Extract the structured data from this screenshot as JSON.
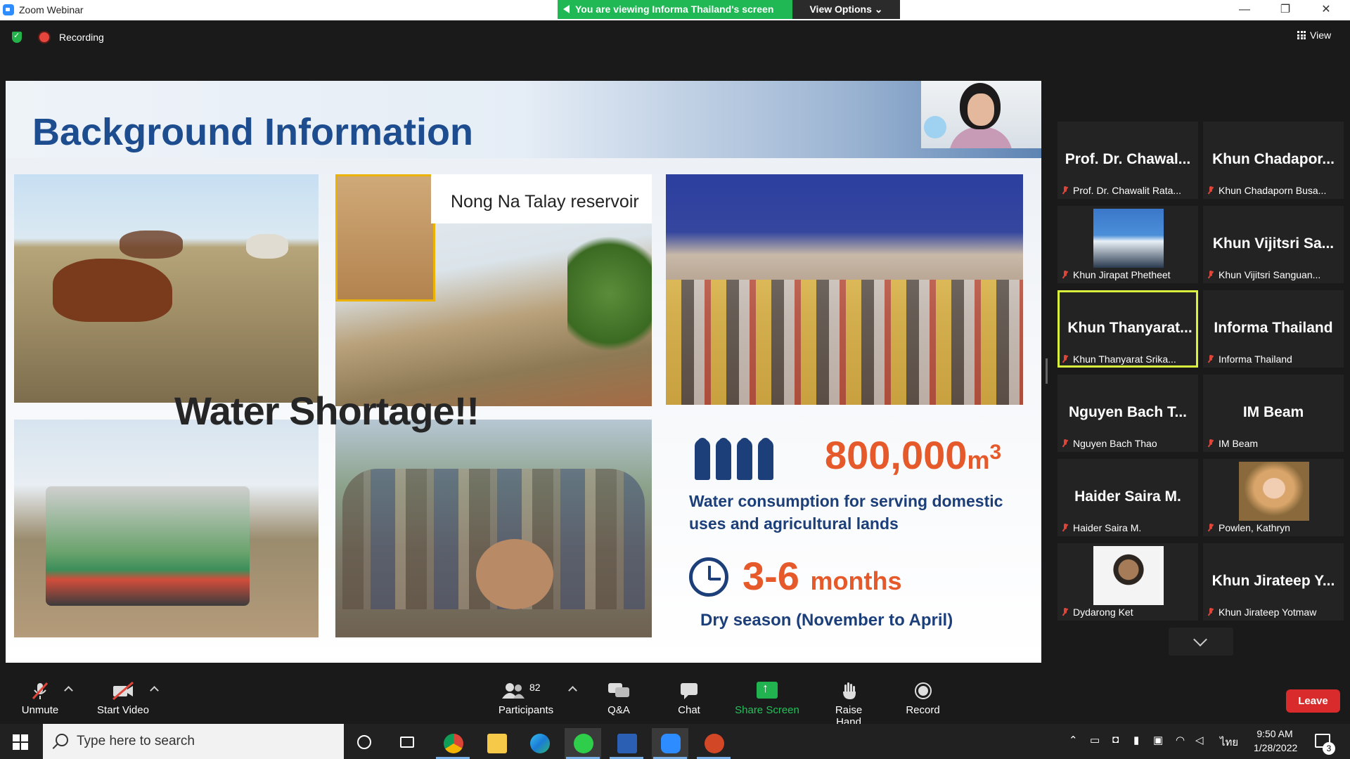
{
  "window": {
    "title": "Zoom Webinar",
    "viewing_banner": "You are viewing Informa Thailand's screen",
    "view_options": "View Options",
    "minimize": "—",
    "restore": "❐",
    "close": "✕"
  },
  "status": {
    "recording_label": "Recording",
    "view_label": "View"
  },
  "slide": {
    "title": "Background Information",
    "reservoir_label": "Nong Na Talay reservoir",
    "headline": "Water Shortage!!",
    "volume_value": "800,000",
    "volume_unit": "m",
    "volume_sup": "3",
    "consumption_text_line1": "Water consumption for serving domestic",
    "consumption_text_line2": "uses and agricultural lands",
    "duration_value": "3-6",
    "duration_unit": "months",
    "dry_season": "Dry season (November to April)"
  },
  "participants": [
    {
      "display": "Prof. Dr. Chawal...",
      "label": "Prof. Dr. Chawalit Rata...",
      "photo": false,
      "active": false
    },
    {
      "display": "Khun Chadapor...",
      "label": "Khun Chadaporn Busa...",
      "photo": false,
      "active": false
    },
    {
      "display": "",
      "label": "Khun Jirapat Phetheet",
      "photo": "jirapat",
      "active": false
    },
    {
      "display": "Khun Vijitsri Sa...",
      "label": "Khun Vijitsri Sanguan...",
      "photo": false,
      "active": false
    },
    {
      "display": "Khun Thanyarat...",
      "label": "Khun Thanyarat Srika...",
      "photo": false,
      "active": true
    },
    {
      "display": "Informa Thailand",
      "label": "Informa Thailand",
      "photo": false,
      "active": false
    },
    {
      "display": "Nguyen Bach T...",
      "label": "Nguyen Bach Thao",
      "photo": false,
      "active": false
    },
    {
      "display": "IM Beam",
      "label": "IM Beam",
      "photo": false,
      "active": false
    },
    {
      "display": "Haider Saira M.",
      "label": "Haider Saira M.",
      "photo": false,
      "active": false
    },
    {
      "display": "",
      "label": "Powlen, Kathryn",
      "photo": "powlen",
      "active": false
    },
    {
      "display": "",
      "label": "Dydarong Ket",
      "photo": "dydarong",
      "active": false
    },
    {
      "display": "Khun Jirateep Y...",
      "label": "Khun Jirateep Yotmaw",
      "photo": false,
      "active": false
    }
  ],
  "toolbar": {
    "unmute": "Unmute",
    "start_video": "Start Video",
    "participants": "Participants",
    "participants_count": "82",
    "qa": "Q&A",
    "chat": "Chat",
    "share_screen": "Share Screen",
    "raise_hand": "Raise Hand",
    "record": "Record",
    "leave": "Leave"
  },
  "taskbar": {
    "search_placeholder": "Type here to search",
    "lang": "ไทย",
    "time": "9:50 AM",
    "date": "1/28/2022",
    "notifications": "3"
  },
  "colors": {
    "accent_green": "#1fb854",
    "leave_red": "#d92b2b",
    "slide_title_blue": "#1d4d8f",
    "stat_orange": "#e6592a",
    "active_speaker_border": "#d8f23d"
  }
}
